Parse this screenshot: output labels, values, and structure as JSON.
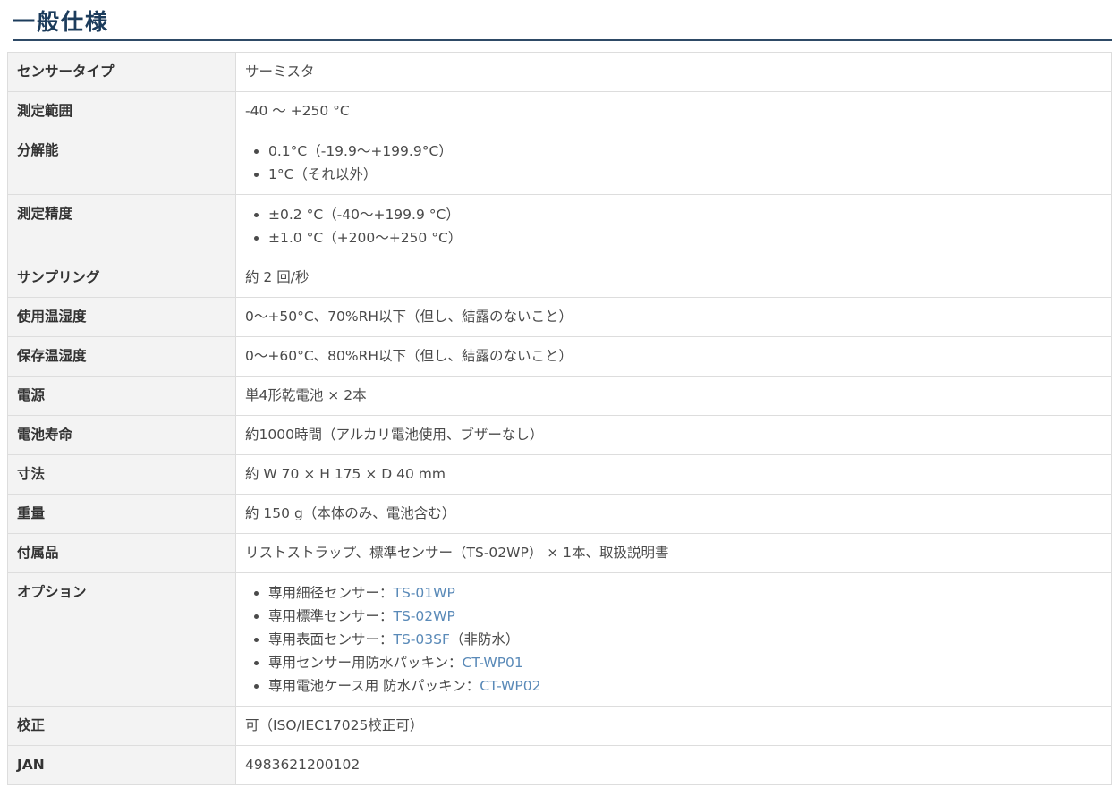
{
  "page": {
    "title": "一般仕様"
  },
  "specs": [
    {
      "key": "センサータイプ",
      "value": "サーミスタ"
    },
    {
      "key": "測定範囲",
      "value": "-40 〜 +250 °C"
    },
    {
      "key": "分解能",
      "items": [
        "0.1°C（-19.9〜+199.9°C）",
        "1°C（それ以外）"
      ]
    },
    {
      "key": "測定精度",
      "items": [
        "±0.2 °C（-40〜+199.9 °C）",
        "±1.0 °C（+200〜+250 °C）"
      ]
    },
    {
      "key": "サンプリング",
      "value": "約 2 回/秒"
    },
    {
      "key": "使用温湿度",
      "value": "0〜+50°C、70%RH以下（但し、結露のないこと）"
    },
    {
      "key": "保存温湿度",
      "value": "0〜+60°C、80%RH以下（但し、結露のないこと）"
    },
    {
      "key": "電源",
      "value": "単4形乾電池 × 2本"
    },
    {
      "key": "電池寿命",
      "value": "約1000時間（アルカリ電池使用、ブザーなし）"
    },
    {
      "key": "寸法",
      "value": "約 W 70 × H 175 × D 40 mm"
    },
    {
      "key": "重量",
      "value": "約 150 g（本体のみ、電池含む）"
    },
    {
      "key": "付属品",
      "value": "リストストラップ、標準センサー（TS-02WP） × 1本、取扱説明書"
    },
    {
      "key": "オプション",
      "options": [
        {
          "label": "専用細径センサー：",
          "link": "TS-01WP",
          "suffix": ""
        },
        {
          "label": "専用標準センサー：",
          "link": "TS-02WP",
          "suffix": ""
        },
        {
          "label": "専用表面センサー：",
          "link": "TS-03SF",
          "suffix": "（非防水）"
        },
        {
          "label": "専用センサー用防水パッキン：",
          "link": "CT-WP01",
          "suffix": ""
        },
        {
          "label": "専用電池ケース用 防水パッキン：",
          "link": "CT-WP02",
          "suffix": ""
        }
      ]
    },
    {
      "key": "校正",
      "value": "可（ISO/IEC17025校正可）"
    },
    {
      "key": "JAN",
      "value": "4983621200102"
    }
  ]
}
